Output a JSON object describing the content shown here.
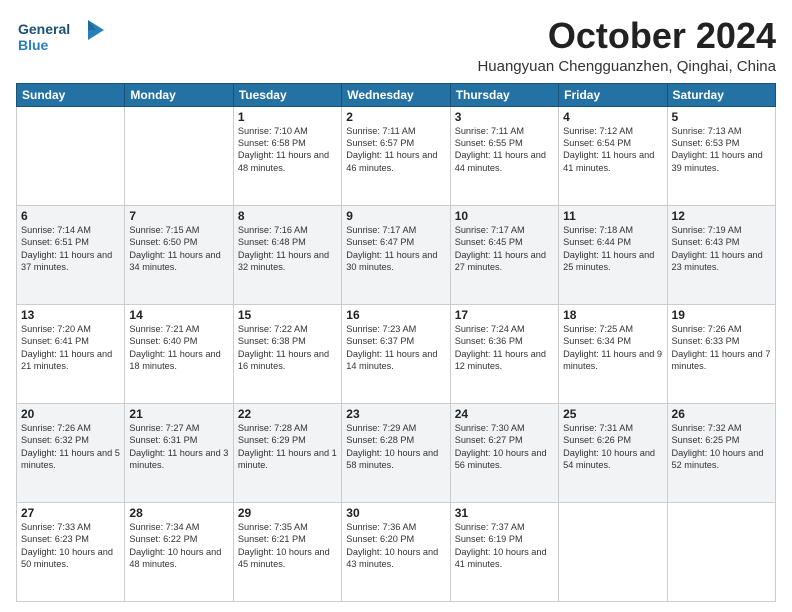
{
  "logo": {
    "line1": "General",
    "line2": "Blue"
  },
  "header": {
    "month": "October 2024",
    "location": "Huangyuan Chengguanzhen, Qinghai, China"
  },
  "weekdays": [
    "Sunday",
    "Monday",
    "Tuesday",
    "Wednesday",
    "Thursday",
    "Friday",
    "Saturday"
  ],
  "weeks": [
    [
      {
        "day": "",
        "content": ""
      },
      {
        "day": "",
        "content": ""
      },
      {
        "day": "1",
        "content": "Sunrise: 7:10 AM\nSunset: 6:58 PM\nDaylight: 11 hours and 48 minutes."
      },
      {
        "day": "2",
        "content": "Sunrise: 7:11 AM\nSunset: 6:57 PM\nDaylight: 11 hours and 46 minutes."
      },
      {
        "day": "3",
        "content": "Sunrise: 7:11 AM\nSunset: 6:55 PM\nDaylight: 11 hours and 44 minutes."
      },
      {
        "day": "4",
        "content": "Sunrise: 7:12 AM\nSunset: 6:54 PM\nDaylight: 11 hours and 41 minutes."
      },
      {
        "day": "5",
        "content": "Sunrise: 7:13 AM\nSunset: 6:53 PM\nDaylight: 11 hours and 39 minutes."
      }
    ],
    [
      {
        "day": "6",
        "content": "Sunrise: 7:14 AM\nSunset: 6:51 PM\nDaylight: 11 hours and 37 minutes."
      },
      {
        "day": "7",
        "content": "Sunrise: 7:15 AM\nSunset: 6:50 PM\nDaylight: 11 hours and 34 minutes."
      },
      {
        "day": "8",
        "content": "Sunrise: 7:16 AM\nSunset: 6:48 PM\nDaylight: 11 hours and 32 minutes."
      },
      {
        "day": "9",
        "content": "Sunrise: 7:17 AM\nSunset: 6:47 PM\nDaylight: 11 hours and 30 minutes."
      },
      {
        "day": "10",
        "content": "Sunrise: 7:17 AM\nSunset: 6:45 PM\nDaylight: 11 hours and 27 minutes."
      },
      {
        "day": "11",
        "content": "Sunrise: 7:18 AM\nSunset: 6:44 PM\nDaylight: 11 hours and 25 minutes."
      },
      {
        "day": "12",
        "content": "Sunrise: 7:19 AM\nSunset: 6:43 PM\nDaylight: 11 hours and 23 minutes."
      }
    ],
    [
      {
        "day": "13",
        "content": "Sunrise: 7:20 AM\nSunset: 6:41 PM\nDaylight: 11 hours and 21 minutes."
      },
      {
        "day": "14",
        "content": "Sunrise: 7:21 AM\nSunset: 6:40 PM\nDaylight: 11 hours and 18 minutes."
      },
      {
        "day": "15",
        "content": "Sunrise: 7:22 AM\nSunset: 6:38 PM\nDaylight: 11 hours and 16 minutes."
      },
      {
        "day": "16",
        "content": "Sunrise: 7:23 AM\nSunset: 6:37 PM\nDaylight: 11 hours and 14 minutes."
      },
      {
        "day": "17",
        "content": "Sunrise: 7:24 AM\nSunset: 6:36 PM\nDaylight: 11 hours and 12 minutes."
      },
      {
        "day": "18",
        "content": "Sunrise: 7:25 AM\nSunset: 6:34 PM\nDaylight: 11 hours and 9 minutes."
      },
      {
        "day": "19",
        "content": "Sunrise: 7:26 AM\nSunset: 6:33 PM\nDaylight: 11 hours and 7 minutes."
      }
    ],
    [
      {
        "day": "20",
        "content": "Sunrise: 7:26 AM\nSunset: 6:32 PM\nDaylight: 11 hours and 5 minutes."
      },
      {
        "day": "21",
        "content": "Sunrise: 7:27 AM\nSunset: 6:31 PM\nDaylight: 11 hours and 3 minutes."
      },
      {
        "day": "22",
        "content": "Sunrise: 7:28 AM\nSunset: 6:29 PM\nDaylight: 11 hours and 1 minute."
      },
      {
        "day": "23",
        "content": "Sunrise: 7:29 AM\nSunset: 6:28 PM\nDaylight: 10 hours and 58 minutes."
      },
      {
        "day": "24",
        "content": "Sunrise: 7:30 AM\nSunset: 6:27 PM\nDaylight: 10 hours and 56 minutes."
      },
      {
        "day": "25",
        "content": "Sunrise: 7:31 AM\nSunset: 6:26 PM\nDaylight: 10 hours and 54 minutes."
      },
      {
        "day": "26",
        "content": "Sunrise: 7:32 AM\nSunset: 6:25 PM\nDaylight: 10 hours and 52 minutes."
      }
    ],
    [
      {
        "day": "27",
        "content": "Sunrise: 7:33 AM\nSunset: 6:23 PM\nDaylight: 10 hours and 50 minutes."
      },
      {
        "day": "28",
        "content": "Sunrise: 7:34 AM\nSunset: 6:22 PM\nDaylight: 10 hours and 48 minutes."
      },
      {
        "day": "29",
        "content": "Sunrise: 7:35 AM\nSunset: 6:21 PM\nDaylight: 10 hours and 45 minutes."
      },
      {
        "day": "30",
        "content": "Sunrise: 7:36 AM\nSunset: 6:20 PM\nDaylight: 10 hours and 43 minutes."
      },
      {
        "day": "31",
        "content": "Sunrise: 7:37 AM\nSunset: 6:19 PM\nDaylight: 10 hours and 41 minutes."
      },
      {
        "day": "",
        "content": ""
      },
      {
        "day": "",
        "content": ""
      }
    ]
  ]
}
